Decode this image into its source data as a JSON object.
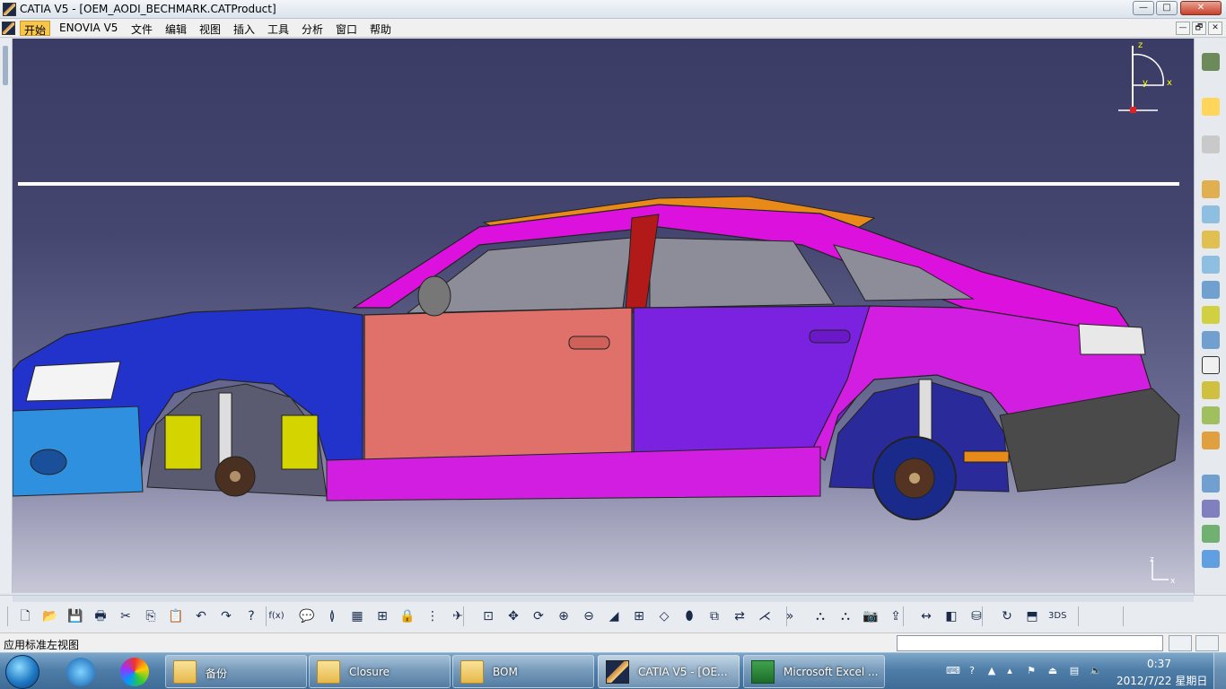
{
  "window": {
    "title": "CATIA V5 - [OEM_AODI_BECHMARK.CATProduct]",
    "min_glyph": "—",
    "max_glyph": "□",
    "close_glyph": "✕"
  },
  "menubar": {
    "items": [
      {
        "label": "开始"
      },
      {
        "label": "ENOVIA V5"
      },
      {
        "label": "文件"
      },
      {
        "label": "编辑"
      },
      {
        "label": "视图"
      },
      {
        "label": "插入"
      },
      {
        "label": "工具"
      },
      {
        "label": "分析"
      },
      {
        "label": "窗口"
      },
      {
        "label": "帮助"
      }
    ],
    "mdi": [
      "—",
      "🗗",
      "✕"
    ]
  },
  "viewport": {
    "compass": {
      "z": "z",
      "x": "x",
      "y": "y"
    },
    "corner_axis": {
      "z": "z",
      "x": "x"
    },
    "model": "car-body-side-view",
    "colors": {
      "background_top": "#3b3c66",
      "front_fender": "#2233cc",
      "front_door": "#e0706a",
      "rear_door": "#7a22e0",
      "rear_quarter": "#d21ee0",
      "roof": "#dd11dd",
      "bumper_front": "#2f90e0",
      "bumper_rear": "#4a4a4a"
    }
  },
  "right_toolbar": {
    "icons": [
      "gears-icon",
      "select-arrow-icon",
      "select-gear-icon",
      "product-assembly-icon",
      "existing-component-icon",
      "component-gear-icon",
      "replace-component-icon",
      "graph-tree-icon",
      "reorder-icon",
      "generate-numbering-icon",
      "fast-multi-instantiation-icon",
      "reconnect-icon",
      "manipulate-icon",
      "snap-icon",
      "explode-icon",
      "clash-icon",
      "smart-move-icon"
    ]
  },
  "bottom_toolbar": {
    "icons": [
      {
        "name": "new-icon",
        "glyph": "🗋"
      },
      {
        "name": "open-icon",
        "glyph": "📂"
      },
      {
        "name": "save-icon",
        "glyph": "💾"
      },
      {
        "name": "print-icon",
        "glyph": "🖶"
      },
      {
        "name": "cut-icon",
        "glyph": "✂"
      },
      {
        "name": "copy-icon",
        "glyph": "⎘"
      },
      {
        "name": "paste-icon",
        "glyph": "📋"
      },
      {
        "name": "undo-icon",
        "glyph": "↶"
      },
      {
        "name": "redo-icon",
        "glyph": "↷"
      },
      {
        "name": "help-icon",
        "glyph": "?"
      },
      {
        "name": "formula-icon",
        "glyph": "f(x)"
      },
      {
        "name": "comment-icon",
        "glyph": "💬"
      },
      {
        "name": "knowledge-icon",
        "glyph": "≬"
      },
      {
        "name": "table-icon",
        "glyph": "▦"
      },
      {
        "name": "hierarchy-icon",
        "glyph": "⊞"
      },
      {
        "name": "lock-icon",
        "glyph": "🔒"
      },
      {
        "name": "catalog-icon",
        "glyph": "⋮"
      },
      {
        "name": "fly-icon",
        "glyph": "✈"
      },
      {
        "name": "fit-all-icon",
        "glyph": "⊡"
      },
      {
        "name": "pan-icon",
        "glyph": "✥"
      },
      {
        "name": "rotate-icon",
        "glyph": "⟳"
      },
      {
        "name": "zoom-in-icon",
        "glyph": "⊕"
      },
      {
        "name": "zoom-out-icon",
        "glyph": "⊖"
      },
      {
        "name": "normal-view-icon",
        "glyph": "◢"
      },
      {
        "name": "multi-view-icon",
        "glyph": "⊞"
      },
      {
        "name": "iso-view-icon",
        "glyph": "◇"
      },
      {
        "name": "shading-icon",
        "glyph": "⬮"
      },
      {
        "name": "hide-show-icon",
        "glyph": "⧉"
      },
      {
        "name": "swap-space-icon",
        "glyph": "⇄"
      },
      {
        "name": "measure-between-icon",
        "glyph": "⋌"
      },
      {
        "name": "measure-item-icon",
        "glyph": "»"
      },
      {
        "name": "apply-material-icon",
        "glyph": "⛬"
      },
      {
        "name": "inertia-icon",
        "glyph": "⛬"
      },
      {
        "name": "capture-icon",
        "glyph": "📷"
      },
      {
        "name": "publish-icon",
        "glyph": "⇪"
      },
      {
        "name": "distance-icon",
        "glyph": "↔"
      },
      {
        "name": "section-icon",
        "glyph": "◧"
      },
      {
        "name": "clash-analysis-icon",
        "glyph": "⛁"
      },
      {
        "name": "update-icon",
        "glyph": "↻"
      },
      {
        "name": "sketch-icon",
        "glyph": "⬒"
      },
      {
        "name": "catia-logo-icon",
        "glyph": "3DS"
      }
    ]
  },
  "statusbar": {
    "text": "应用标准左视图",
    "input_value": ""
  },
  "taskbar": {
    "start_label": "",
    "items": [
      {
        "label": "备份",
        "kind": "folder"
      },
      {
        "label": "Closure",
        "kind": "folder"
      },
      {
        "label": "BOM",
        "kind": "folder"
      },
      {
        "label": "CATIA V5 - [OE...",
        "kind": "catia",
        "active": true
      },
      {
        "label": "Microsoft Excel ...",
        "kind": "excel"
      }
    ],
    "clock": {
      "time": "0:37",
      "date": "2012/7/22 星期日"
    }
  }
}
